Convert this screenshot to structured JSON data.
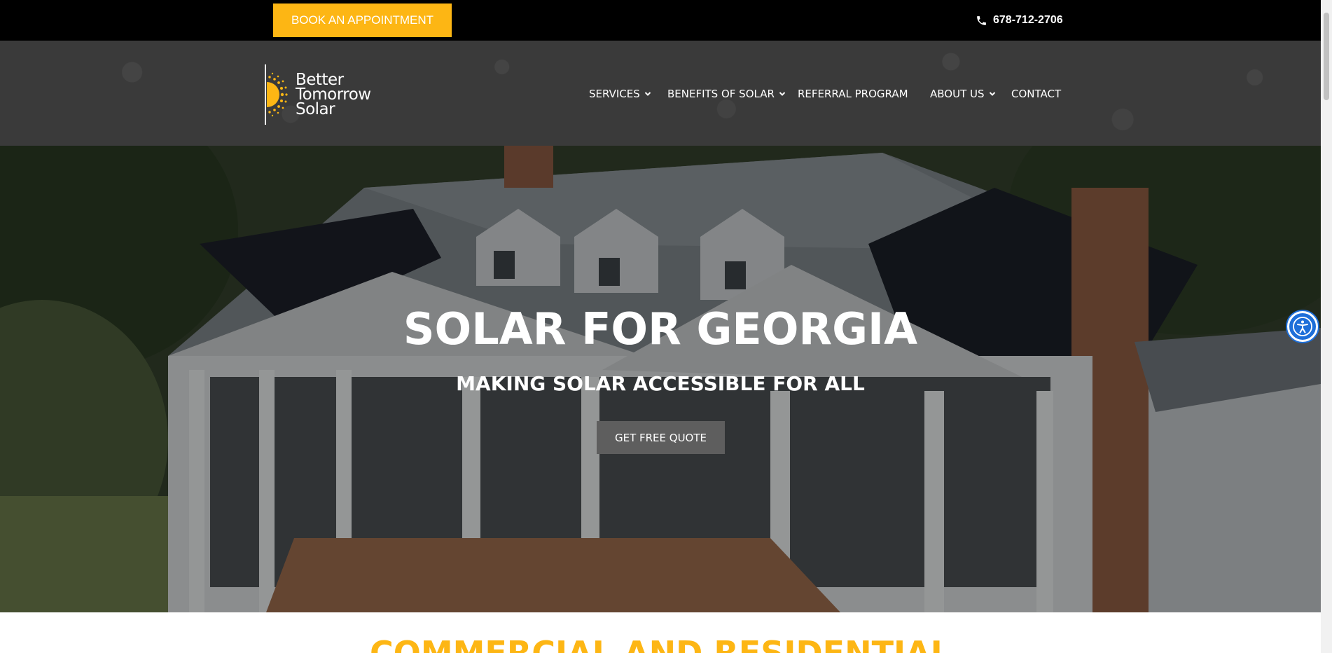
{
  "topbar": {
    "book_label": "BOOK AN APPOINTMENT",
    "phone": "678-712-2706",
    "phone_icon": "phone-icon",
    "accent": "#fdb614"
  },
  "header": {
    "logo": {
      "line1": "Better",
      "line2": "Tomorrow",
      "line3": "Solar",
      "icon": "sun-logo-icon"
    },
    "nav": [
      {
        "label": "SERVICES",
        "has_dropdown": true
      },
      {
        "label": "BENEFITS OF SOLAR",
        "has_dropdown": true
      },
      {
        "label": "REFERRAL PROGRAM",
        "has_dropdown": false
      },
      {
        "label": "ABOUT US",
        "has_dropdown": true
      },
      {
        "label": "CONTACT",
        "has_dropdown": false
      }
    ]
  },
  "hero": {
    "title": "SOLAR FOR GEORGIA",
    "subtitle": "MAKING SOLAR ACCESSIBLE FOR ALL",
    "cta_label": "GET FREE QUOTE"
  },
  "section": {
    "title": "COMMERCIAL AND RESIDENTIAL"
  },
  "accessibility": {
    "icon": "accessibility-icon"
  }
}
